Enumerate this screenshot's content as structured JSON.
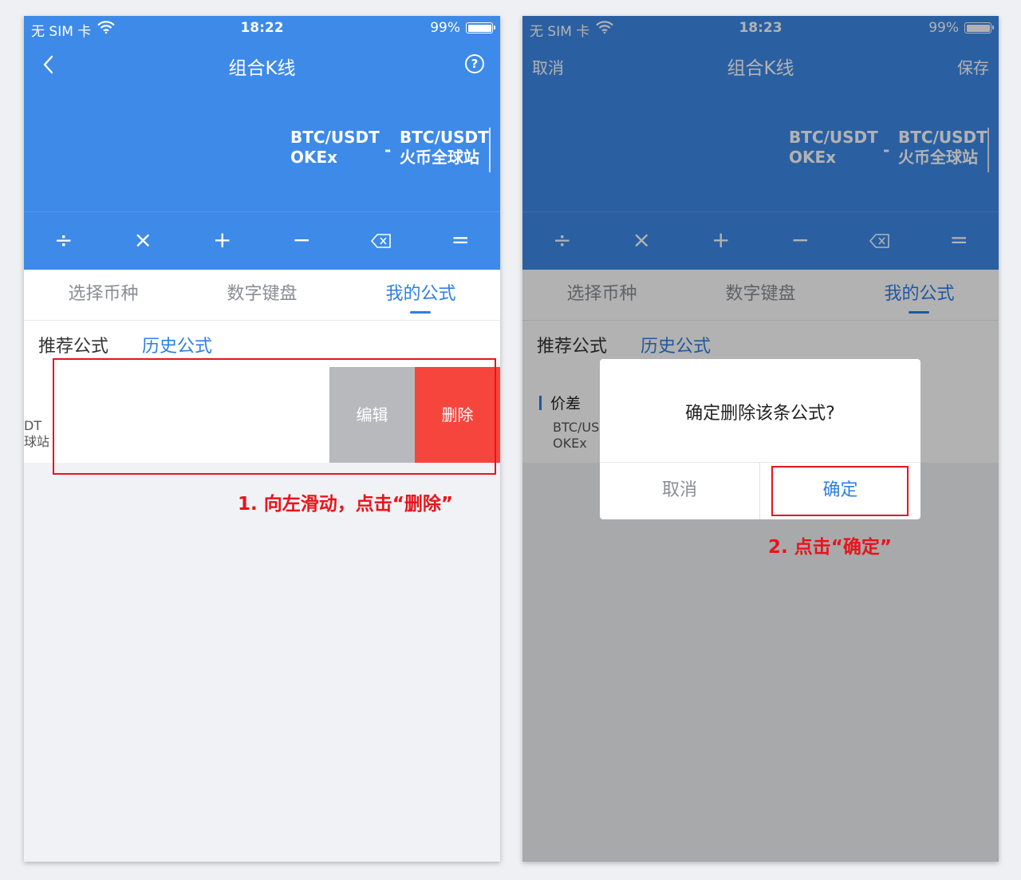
{
  "colors": {
    "primary_blue": "#3d8ae8",
    "active_tab_blue": "#2f7fe0",
    "delete_red": "#f5453d",
    "edit_gray": "#b8b9bc",
    "annotation_red": "#e8141a",
    "page_bg": "#f1f2f5"
  },
  "calc_keys": [
    {
      "symbol": "÷",
      "icon": "divide-icon"
    },
    {
      "symbol": "×",
      "icon": "multiply-icon"
    },
    {
      "symbol": "+",
      "icon": "plus-icon"
    },
    {
      "symbol": "−",
      "icon": "minus-icon"
    },
    {
      "symbol": "",
      "icon": "backspace-icon"
    },
    {
      "symbol": "=",
      "icon": "equals-icon"
    }
  ],
  "left": {
    "status": {
      "carrier": "无 SIM 卡",
      "time": "18:22",
      "battery": "99%"
    },
    "nav": {
      "title": "组合K线"
    },
    "formula": {
      "pair1_line1": "BTC/USDT",
      "pair1_line2": "OKEx",
      "operator": "-",
      "pair2_line1": "BTC/USDT",
      "pair2_line2": "火币全球站"
    },
    "tabs": [
      "选择币种",
      "数字键盘",
      "我的公式"
    ],
    "subtabs": [
      "推荐公式",
      "历史公式"
    ],
    "item": {
      "peek_line1": "DT",
      "peek_line2": "球站"
    },
    "actions": {
      "edit": "编辑",
      "delete": "删除"
    },
    "annotation": "1. 向左滑动，点击“删除”"
  },
  "right": {
    "status": {
      "carrier": "无 SIM 卡",
      "time": "18:23",
      "battery": "99%"
    },
    "nav": {
      "title": "组合K线",
      "cancel": "取消",
      "save": "保存"
    },
    "formula": {
      "pair1_line1": "BTC/USDT",
      "pair1_line2": "OKEx",
      "operator": "-",
      "pair2_line1": "BTC/USDT",
      "pair2_line2": "火币全球站"
    },
    "tabs": [
      "选择币种",
      "数字键盘",
      "我的公式"
    ],
    "subtabs": [
      "推荐公式",
      "历史公式"
    ],
    "item": {
      "title": "价差",
      "line1": "BTC/US",
      "line2": "OKEx"
    },
    "dialog": {
      "message": "确定删除该条公式?",
      "cancel": "取消",
      "confirm": "确定"
    },
    "annotation": "2. 点击“确定”"
  }
}
